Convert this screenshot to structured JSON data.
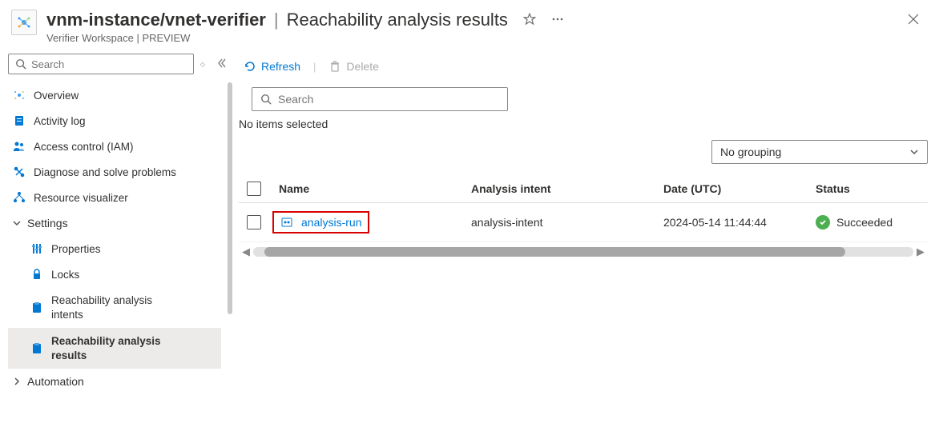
{
  "header": {
    "title": "vnm-instance/vnet-verifier",
    "page": "Reachability analysis results",
    "sub": "Verifier Workspace | PREVIEW"
  },
  "sidebar": {
    "search_placeholder": "Search",
    "items": [
      {
        "label": "Overview"
      },
      {
        "label": "Activity log"
      },
      {
        "label": "Access control (IAM)"
      },
      {
        "label": "Diagnose and solve problems"
      },
      {
        "label": "Resource visualizer"
      }
    ],
    "settings_label": "Settings",
    "settings_items": [
      {
        "label": "Properties"
      },
      {
        "label": "Locks"
      },
      {
        "label1": "Reachability analysis",
        "label2": "intents"
      },
      {
        "label1": "Reachability analysis",
        "label2": "results"
      }
    ],
    "automation_label": "Automation"
  },
  "toolbar": {
    "refresh_label": "Refresh",
    "delete_label": "Delete"
  },
  "main": {
    "search_placeholder": "Search",
    "no_items_text": "No items selected",
    "grouping_label": "No grouping"
  },
  "grid": {
    "cols": {
      "name": "Name",
      "intent": "Analysis intent",
      "date": "Date (UTC)",
      "status": "Status"
    },
    "rows": [
      {
        "name": "analysis-run",
        "intent": "analysis-intent",
        "date": "2024-05-14 11:44:44",
        "status": "Succeeded"
      }
    ]
  }
}
